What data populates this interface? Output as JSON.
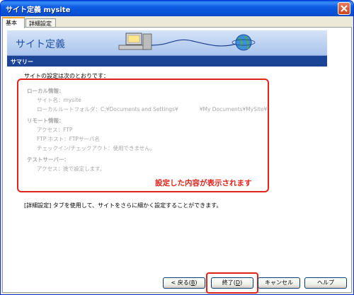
{
  "window": {
    "title": "サイト定義 mysite"
  },
  "tabs": [
    {
      "label": "基本"
    },
    {
      "label": "詳細設定"
    }
  ],
  "banner": {
    "title": "サイト定義"
  },
  "section": {
    "label": "サマリー"
  },
  "intro_text": "サイトの設定は次のとおりです：",
  "summary": {
    "local_heading": "ローカル情報：",
    "site_name": "サイト名：mysite",
    "local_root": "ローカルルートフォルダ：C:¥Documents and Settings¥　　　　¥My Documents¥MySite¥",
    "remote_heading": "リモート情報：",
    "access": "アクセス：FTP",
    "ftp_host": "FTP ホスト：FTPサーバ名",
    "checkin": "チェックイン/チェックアウト：使用できません。",
    "test_heading": "テストサーバー：",
    "test_access": "アクセス：後で設定します。"
  },
  "highlight_note": "設定した内容が表示されます",
  "footer_note": "[詳細設定] タブを使用して、サイトをさらに細かく設定することができます。",
  "buttons": {
    "back_prefix": "< 戻る(",
    "back_key": "B",
    "back_suffix": ")",
    "finish_prefix": "終了(",
    "finish_key": "D",
    "finish_suffix": ")",
    "cancel": "キャンセル",
    "help": "ヘルプ"
  },
  "colors": {
    "accent_red": "#e0241b",
    "section_bar": "#1b4497",
    "titlebar": "#0851d4"
  }
}
